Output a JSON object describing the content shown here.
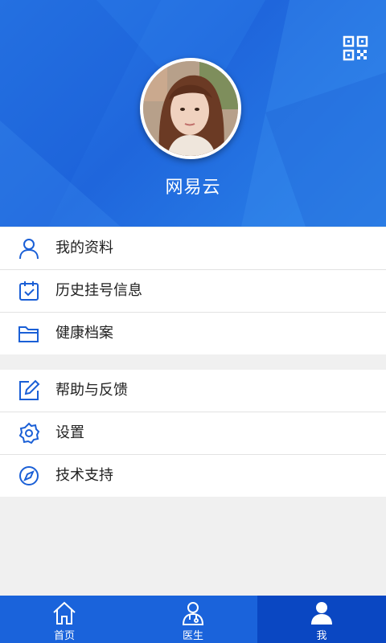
{
  "header": {
    "username": "网易云",
    "qr_icon": "qr-code-icon",
    "avatar": "user-avatar"
  },
  "menu_group_1": [
    {
      "label": "我的资料",
      "icon": "person-icon"
    },
    {
      "label": "历史挂号信息",
      "icon": "calendar-check-icon"
    },
    {
      "label": "健康档案",
      "icon": "folder-icon"
    }
  ],
  "menu_group_2": [
    {
      "label": "帮助与反馈",
      "icon": "edit-icon"
    },
    {
      "label": "设置",
      "icon": "gear-icon"
    },
    {
      "label": "技术支持",
      "icon": "compass-icon"
    }
  ],
  "tabs": [
    {
      "label": "首页",
      "icon": "home-icon"
    },
    {
      "label": "医生",
      "icon": "doctor-icon"
    },
    {
      "label": "我",
      "icon": "profile-icon",
      "active": true
    }
  ],
  "colors": {
    "primary": "#1f66dc",
    "tab_active": "#0a47c2",
    "icon_blue": "#1a5fd6"
  }
}
